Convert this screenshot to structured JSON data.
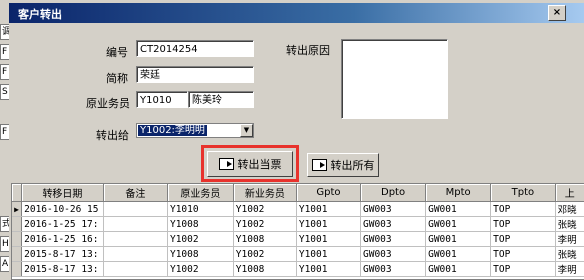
{
  "background_cells": [
    "调",
    "F",
    "F",
    "S",
    "F",
    "式",
    "HA",
    "AL"
  ],
  "window": {
    "title": "客户转出",
    "close_glyph": "×"
  },
  "form": {
    "code_label": "编号",
    "code_value": "CT2014254",
    "short_name_label": "简称",
    "short_name_value": "荣廷",
    "orig_sales_label": "原业务员",
    "orig_sales_code": "Y1010",
    "orig_sales_name": "陈美玲",
    "transfer_to_label": "转出给",
    "transfer_to_value": "Y1002:李明明",
    "reason_label": "转出原因",
    "reason_value": ""
  },
  "buttons": {
    "transfer_current": "转出当票",
    "transfer_all": "转出所有",
    "highlight_color": "#e8322c"
  },
  "grid": {
    "columns": [
      "转移日期",
      "备注",
      "原业务员",
      "新业务员",
      "Gpto",
      "Dpto",
      "Mpto",
      "Tpto",
      "上"
    ],
    "rows": [
      {
        "indicator": "▶",
        "cells": [
          "2016-10-26 15",
          "",
          "Y1010",
          "Y1002",
          "Y1001",
          "GW003",
          "GW001",
          "TOP",
          "邓晓"
        ]
      },
      {
        "indicator": "",
        "cells": [
          "2016-1-25 17:",
          "",
          "Y1008",
          "Y1002",
          "Y1001",
          "GW003",
          "GW001",
          "TOP",
          "张晓"
        ]
      },
      {
        "indicator": "",
        "cells": [
          "2016-1-25 16:",
          "",
          "Y1002",
          "Y1008",
          "Y1001",
          "GW003",
          "GW001",
          "TOP",
          "李明"
        ]
      },
      {
        "indicator": "",
        "cells": [
          "2015-8-17 13:",
          "",
          "Y1008",
          "Y1002",
          "Y1001",
          "GW003",
          "GW001",
          "TOP",
          "张晓"
        ]
      },
      {
        "indicator": "",
        "cells": [
          "2015-8-17 13:",
          "",
          "Y1002",
          "Y1008",
          "Y1001",
          "GW003",
          "GW001",
          "TOP",
          "李明"
        ]
      }
    ]
  }
}
